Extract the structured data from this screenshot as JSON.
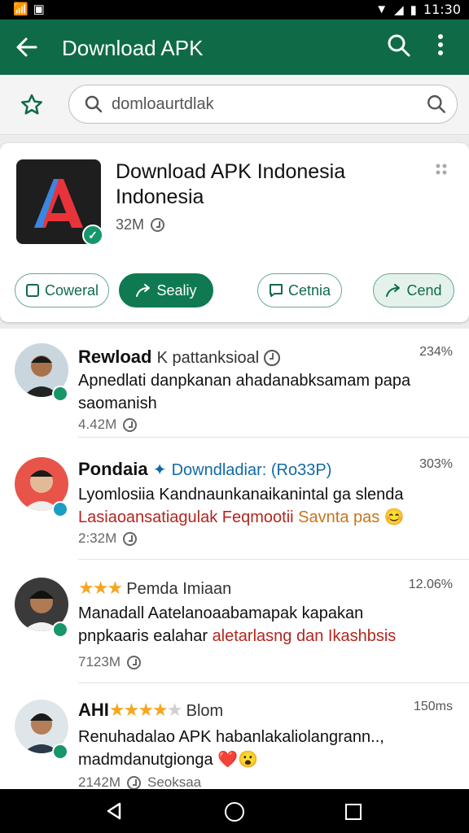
{
  "status_bar": {
    "time": "11:30"
  },
  "app_bar": {
    "title": "Download APK"
  },
  "search": {
    "value": "domloaurtdlak"
  },
  "app": {
    "name": "Download APK Indonesia Indonesia",
    "size": "32M",
    "buttons": [
      {
        "label": "Coweral"
      },
      {
        "label": "Sealiy"
      },
      {
        "label": "Cetnia"
      },
      {
        "label": "Cend"
      }
    ]
  },
  "reviews": [
    {
      "name": "Rewload",
      "meta": "K pattanksioal",
      "percent": "234%",
      "text": "Apnedlati danpkanan ahadanabksamam papa saomanish",
      "time": "4.42M"
    },
    {
      "name": "Pondaia",
      "meta": "Downdladiar: (Ro33P)",
      "percent": "303%",
      "text_line1": "Lyomlosiia Kandnaunkanaikanintal ga slenda",
      "text_red": "Lasiaoansatiagulak Feqmootii",
      "text_orange": "Savnta pas",
      "emoji": "😊",
      "time": "2:32M"
    },
    {
      "name": "Pemda Imiaan",
      "stars": "★★★",
      "percent": "12.06%",
      "text_line1": "Manadall Aatelanoaabamapak kapakan",
      "text_line2": "pnpkaaris ealahar",
      "text_red": "aletarlasng dan Ikashbsis",
      "time": "7123M"
    },
    {
      "name": "AHI",
      "stars_filled": "★★★★",
      "stars_empty": "★",
      "meta": "Blom",
      "percent": "150ms",
      "text": "Renuhadalao APK habanlakaliolangrann.., madmdanutgionga",
      "emoji": "❤️😮",
      "time": "2142M",
      "extra": "Seoksaa"
    }
  ]
}
